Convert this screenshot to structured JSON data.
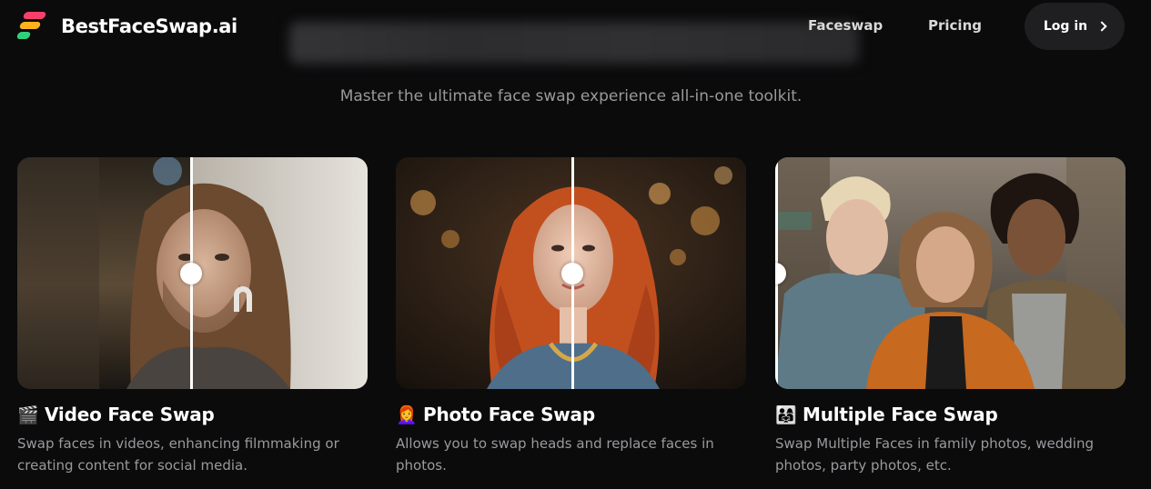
{
  "brand": {
    "name": "BestFaceSwap.ai"
  },
  "nav": {
    "faceswap": "Faceswap",
    "pricing": "Pricing",
    "login": "Log in"
  },
  "hero": {
    "tagline": "Master the ultimate face swap experience all-in-one toolkit."
  },
  "cards": [
    {
      "icon": "🎬",
      "title": "Video Face Swap",
      "description": "Swap faces in videos, enhancing filmmaking or creating content for social media."
    },
    {
      "icon": "👩‍🦰",
      "title": "Photo Face Swap",
      "description": "Allows you to swap heads and replace faces in photos."
    },
    {
      "icon": "👨‍👩‍👧",
      "title": "Multiple Face Swap",
      "description": "Swap Multiple Faces in family photos, wedding photos, party photos, etc."
    }
  ],
  "colors": {
    "background": "#0b0b0c",
    "logo_red": "#f5406b",
    "logo_orange": "#ffb21b",
    "logo_green": "#2fd07b"
  }
}
